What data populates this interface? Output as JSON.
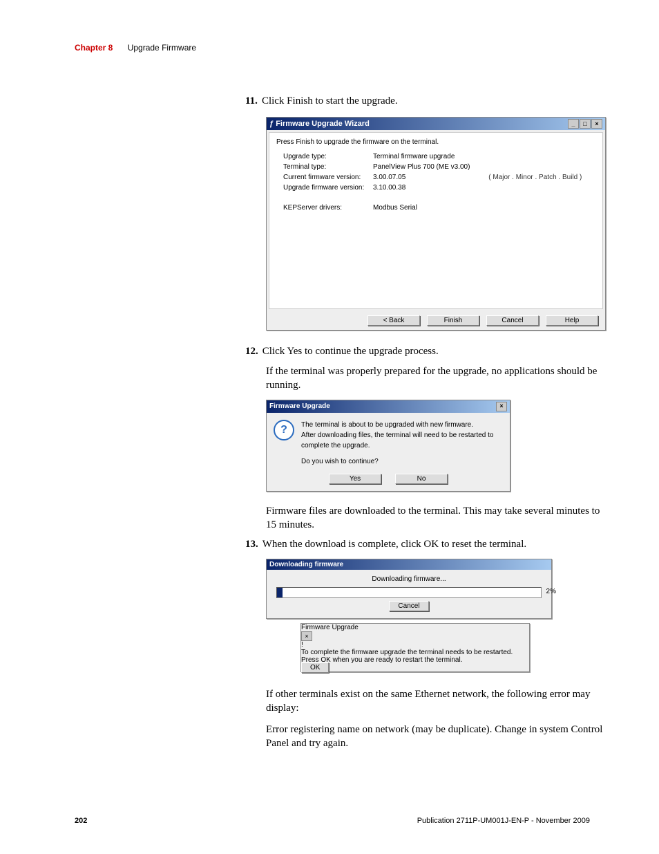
{
  "header": {
    "chapter_label": "Chapter 8",
    "chapter_title": "Upgrade Firmware"
  },
  "steps": {
    "s11": {
      "num": "11.",
      "text": "Click Finish to start the upgrade."
    },
    "s12": {
      "num": "12.",
      "text": "Click Yes to continue the upgrade process."
    },
    "s12_para": "If the terminal was properly prepared for the upgrade, no applications should be running.",
    "after_dialog_para": "Firmware files are downloaded to the terminal. This may take several minutes to 15 minutes.",
    "s13": {
      "num": "13.",
      "text": "When the download is complete, click OK to reset the terminal."
    },
    "end_para1": "If other terminals exist on the same Ethernet network, the following error may display:",
    "end_para2": "Error registering name on network (may be duplicate). Change in system Control Panel and try again."
  },
  "wizard": {
    "title": "Firmware Upgrade Wizard",
    "heading": "Press Finish to upgrade the firmware on the terminal.",
    "fields": {
      "upgrade_type_lbl": "Upgrade type:",
      "upgrade_type_val": "Terminal firmware upgrade",
      "terminal_type_lbl": "Terminal type:",
      "terminal_type_val": "PanelView Plus 700   (ME v3.00)",
      "current_fw_lbl": "Current firmware version:",
      "current_fw_val": "3.00.07.05",
      "fw_annot": "( Major . Minor . Patch . Build )",
      "upgrade_fw_lbl": "Upgrade firmware version:",
      "upgrade_fw_val": "3.10.00.38",
      "kep_lbl": "KEPServer drivers:",
      "kep_val": "Modbus Serial"
    },
    "buttons": {
      "back": "< Back",
      "finish": "Finish",
      "cancel": "Cancel",
      "help": "Help"
    }
  },
  "confirm_dialog": {
    "title": "Firmware Upgrade",
    "line1": "The terminal is about to be upgraded with new firmware.",
    "line2": "After downloading files, the terminal will need to be restarted to complete the upgrade.",
    "line3": "Do you wish to continue?",
    "yes": "Yes",
    "no": "No",
    "close_x": "×",
    "icon_glyph": "?"
  },
  "downloading": {
    "title": "Downloading firmware",
    "label": "Downloading firmware...",
    "percent": "2%",
    "cancel": "Cancel"
  },
  "restart_dialog": {
    "title": "Firmware Upgrade",
    "line1": "To complete the firmware upgrade the terminal needs to be restarted.",
    "line2": "Press OK when you are ready to restart the terminal.",
    "ok": "OK",
    "close_x": "×",
    "icon_glyph": "!"
  },
  "footer": {
    "page_number": "202",
    "publication": "Publication 2711P-UM001J-EN-P - November 2009"
  },
  "window_controls": {
    "min": "_",
    "max": "□",
    "close": "×"
  }
}
